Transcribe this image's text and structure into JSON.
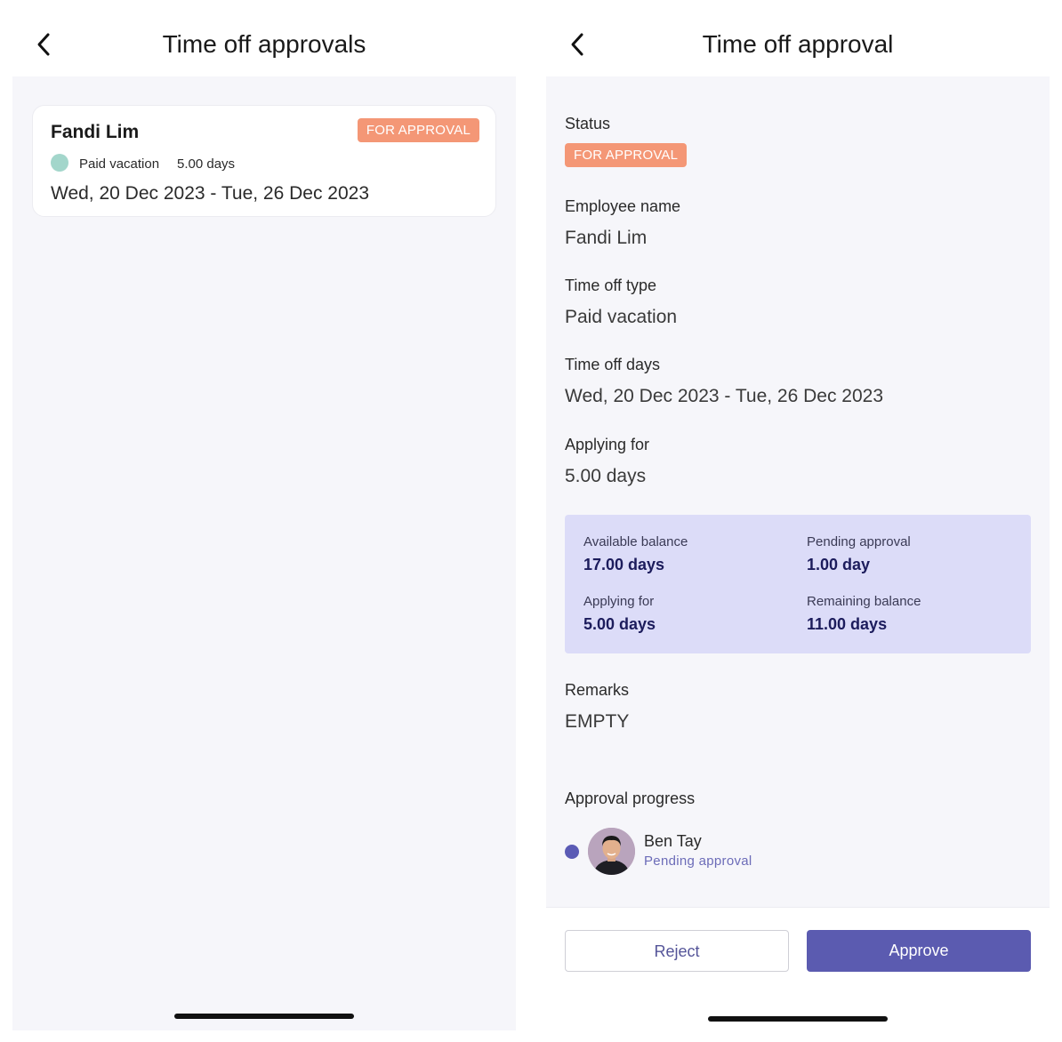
{
  "list_screen": {
    "title": "Time off approvals",
    "card": {
      "employee_name": "Fandi Lim",
      "status": "FOR APPROVAL",
      "time_off_type": "Paid vacation",
      "days": "5.00 days",
      "date_range": "Wed, 20 Dec 2023 - Tue, 26 Dec 2023"
    }
  },
  "detail_screen": {
    "title": "Time off approval",
    "status_label": "Status",
    "status": "FOR APPROVAL",
    "employee_name_label": "Employee name",
    "employee_name": "Fandi Lim",
    "time_off_type_label": "Time off type",
    "time_off_type": "Paid vacation",
    "time_off_days_label": "Time off days",
    "time_off_days": "Wed, 20 Dec 2023 - Tue, 26 Dec 2023",
    "applying_for_label": "Applying for",
    "applying_for": "5.00 days",
    "balance": {
      "available_label": "Available balance",
      "available": "17.00 days",
      "pending_label": "Pending approval",
      "pending": "1.00 day",
      "applying_label": "Applying for",
      "applying": "5.00 days",
      "remaining_label": "Remaining balance",
      "remaining": "11.00 days"
    },
    "remarks_label": "Remarks",
    "remarks": "EMPTY",
    "approval_progress_label": "Approval progress",
    "approver": {
      "name": "Ben Tay",
      "status": "Pending approval"
    },
    "reject_label": "Reject",
    "approve_label": "Approve"
  },
  "colors": {
    "badge": "#f49776",
    "accent": "#5b5bb0",
    "balance_bg": "#dcdcf8",
    "type_dot": "#a3d6cb"
  },
  "icons": [
    "back-chevron-icon",
    "status-dot-icon",
    "avatar"
  ]
}
